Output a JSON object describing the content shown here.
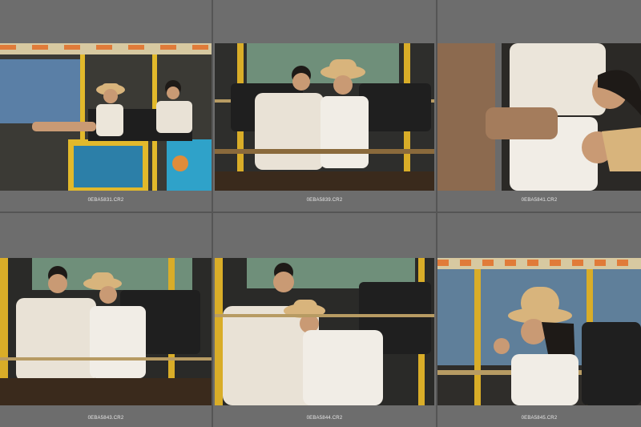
{
  "window": {
    "title": "",
    "background": "#6d6d6d"
  },
  "grid": {
    "columns": 3,
    "rows": 2,
    "items": [
      {
        "filename": "0EBA5831.CR2",
        "thumb_subject": "couple in open-air tour bus, woman in bucket hat with leg up",
        "selected": false
      },
      {
        "filename": "0EBA5839.CR2",
        "thumb_subject": "couple seated in bus, man smiling looking up, woman in bucket hat",
        "selected": false
      },
      {
        "filename": "0EBA5841.CR2",
        "thumb_subject": "couple playful close-up rotated portrait",
        "selected": false
      },
      {
        "filename": "0EBA5843.CR2",
        "thumb_subject": "couple laughing in bus seats",
        "selected": false
      },
      {
        "filename": "0EBA5844.CR2",
        "thumb_subject": "woman resting head on man's shoulder",
        "selected": false
      },
      {
        "filename": "0EBA5845.CR2",
        "thumb_subject": "woman in bucket hat looking out bus window",
        "selected": false
      }
    ]
  },
  "colors": {
    "cell_bg": "#6d6d6d",
    "caption": "#e8e8e8",
    "seat": "#2a2a2a",
    "rail": "#c9a227",
    "shirt": "#e9e2d6",
    "hat": "#d8b47c",
    "skin": "#c99a74",
    "hair": "#1e1a17"
  }
}
